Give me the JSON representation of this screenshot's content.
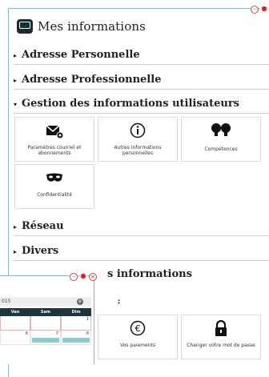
{
  "page": {
    "title": "Mes informations",
    "icon": "chat-icon"
  },
  "window_controls": [
    "minimize-icon",
    "gear-icon",
    "close-icon"
  ],
  "sections": {
    "adresse_perso": "Adresse Personnelle",
    "adresse_pro": "Adresse Professionnelle",
    "gestion": "Gestion des informations utilisateurs",
    "reseau": "Réseau",
    "divers": "Divers"
  },
  "tiles": {
    "courriel": "Paramètres courriel et abonnements",
    "autres": "Autres informations personnelles",
    "competences": "Compétences",
    "confidentialite": "Confidentialité",
    "paiements": "Vos paiements",
    "mot_de_passe": "Changer votre mot de passe"
  },
  "second_panel": {
    "title_partial": "s informations",
    "symbol": ";"
  },
  "calendar": {
    "month_label": "015",
    "days": [
      "Ven",
      "Sam",
      "Dim"
    ],
    "row1": [
      "",
      "",
      "1"
    ],
    "row2": [
      "6",
      "7",
      "8"
    ],
    "accent_color": "#8ecccc",
    "header_color": "#1b3640"
  }
}
